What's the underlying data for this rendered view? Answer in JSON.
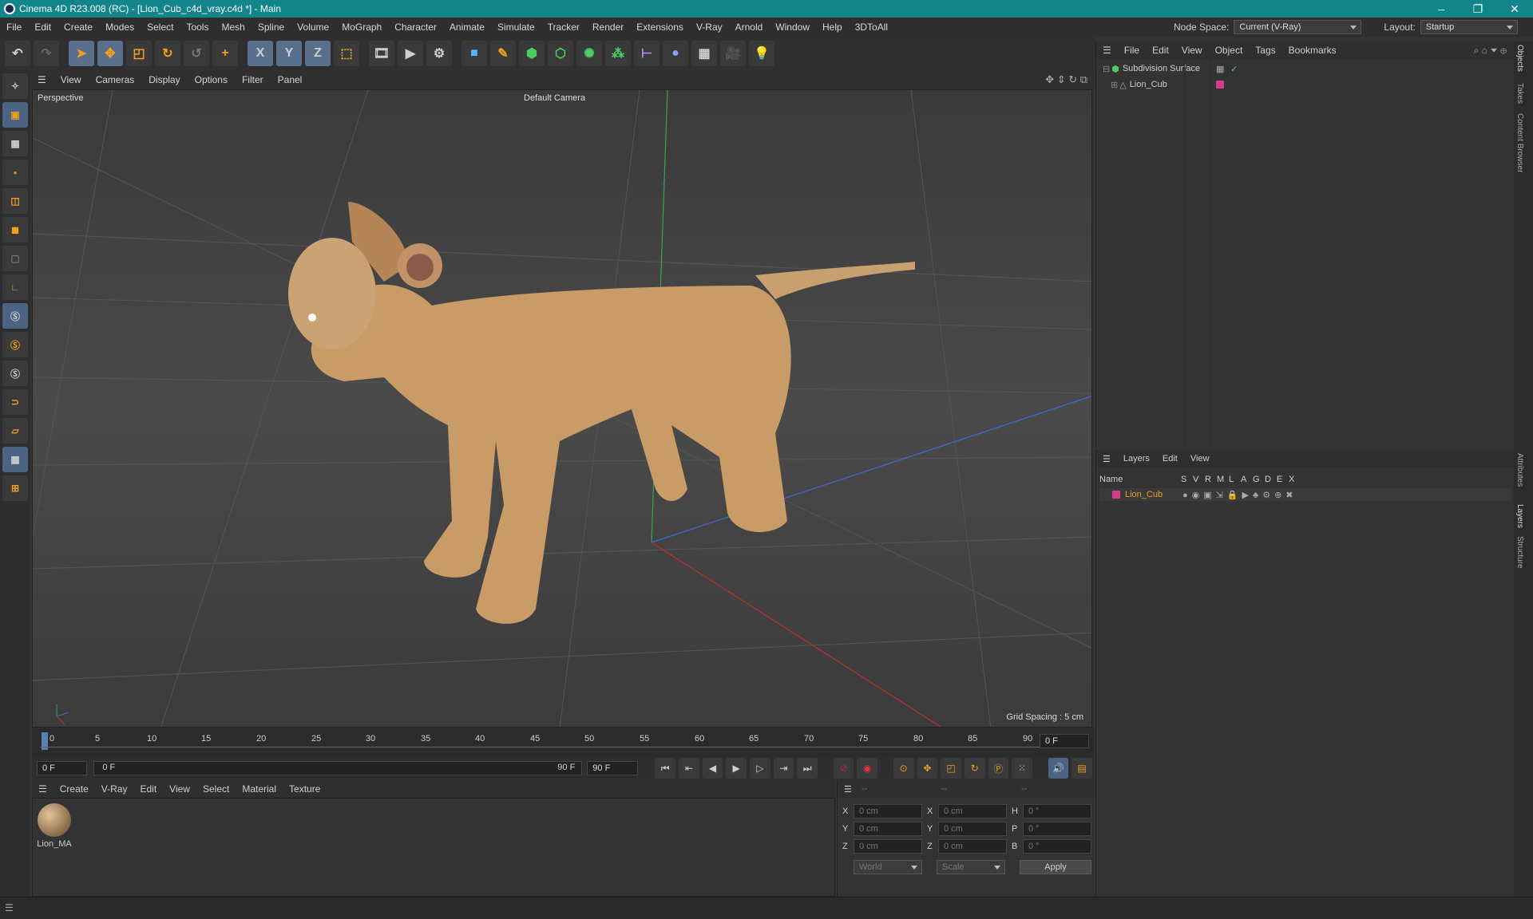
{
  "window": {
    "title": "Cinema 4D R23.008 (RC) - [Lion_Cub_c4d_vray.c4d *] - Main"
  },
  "menubar": {
    "items": [
      "File",
      "Edit",
      "Create",
      "Modes",
      "Select",
      "Tools",
      "Mesh",
      "Spline",
      "Volume",
      "MoGraph",
      "Character",
      "Animate",
      "Simulate",
      "Tracker",
      "Render",
      "Extensions",
      "V-Ray",
      "Arnold",
      "Window",
      "Help",
      "3DToAll"
    ],
    "node_space_label": "Node Space:",
    "node_space_value": "Current (V-Ray)",
    "layout_label": "Layout:",
    "layout_value": "Startup"
  },
  "toolbar": {
    "axis_x": "X",
    "axis_y": "Y",
    "axis_z": "Z"
  },
  "viewport": {
    "menu": [
      "View",
      "Cameras",
      "Display",
      "Options",
      "Filter",
      "Panel"
    ],
    "label": "Perspective",
    "camera": "Default Camera",
    "grid_spacing": "Grid Spacing : 5 cm"
  },
  "timeline": {
    "ticks": [
      "0",
      "5",
      "10",
      "15",
      "20",
      "25",
      "30",
      "35",
      "40",
      "45",
      "50",
      "55",
      "60",
      "65",
      "70",
      "75",
      "80",
      "85",
      "90"
    ],
    "current_frame": "0 F",
    "start": "0 F",
    "range_start": "0 F",
    "range_end": "90 F",
    "end": "90 F"
  },
  "materials": {
    "menu": [
      "Create",
      "V-Ray",
      "Edit",
      "View",
      "Select",
      "Material",
      "Texture"
    ],
    "items": [
      {
        "name": "Lion_MA"
      }
    ]
  },
  "coords": {
    "headers": [
      "--",
      "--",
      "--"
    ],
    "rows": [
      {
        "a": "X",
        "v1": "0 cm",
        "b": "X",
        "v2": "0 cm",
        "c": "H",
        "v3": "0 °"
      },
      {
        "a": "Y",
        "v1": "0 cm",
        "b": "Y",
        "v2": "0 cm",
        "c": "P",
        "v3": "0 °"
      },
      {
        "a": "Z",
        "v1": "0 cm",
        "b": "Z",
        "v2": "0 cm",
        "c": "B",
        "v3": "0 °"
      }
    ],
    "world": "World",
    "scale": "Scale",
    "apply": "Apply"
  },
  "objects": {
    "menu": [
      "File",
      "Edit",
      "View",
      "Object",
      "Tags",
      "Bookmarks"
    ],
    "tree": [
      {
        "name": "Subdivision Surface",
        "indent": 0
      },
      {
        "name": "Lion_Cub",
        "indent": 1
      }
    ]
  },
  "layers": {
    "menu": [
      "Layers",
      "Edit",
      "View"
    ],
    "columns": [
      "Name",
      "S",
      "V",
      "R",
      "M",
      "L",
      "A",
      "G",
      "D",
      "E",
      "X"
    ],
    "rows": [
      {
        "name": "Lion_Cub",
        "color": "#d63a8a"
      }
    ]
  },
  "side_tabs": [
    "Objects",
    "Takes",
    "Content Browser",
    "Attributes",
    "Layers",
    "Structure"
  ],
  "colors": {
    "accent": "#12858a",
    "layer": "#d63a8a",
    "orange": "#f0a020"
  }
}
